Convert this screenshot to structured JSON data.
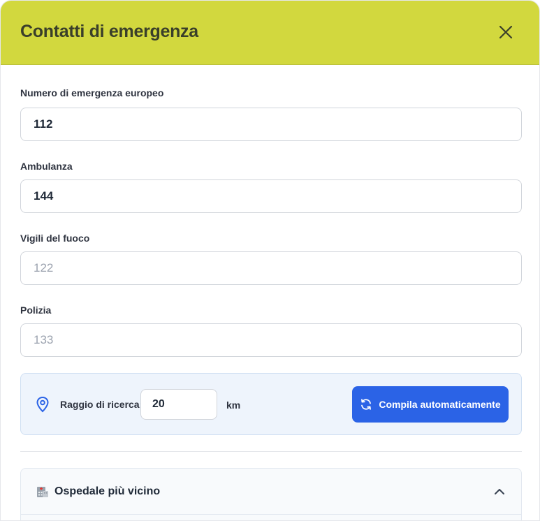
{
  "modal": {
    "title": "Contatti di emergenza",
    "close_icon": "close-icon"
  },
  "fields": [
    {
      "label": "Numero di emergenza europeo",
      "value": "112",
      "placeholder": ""
    },
    {
      "label": "Ambulanza",
      "value": "144",
      "placeholder": ""
    },
    {
      "label": "Vigili del fuoco",
      "value": "",
      "placeholder": "122"
    },
    {
      "label": "Polizia",
      "value": "",
      "placeholder": "133"
    }
  ],
  "radius": {
    "icon": "map-pin-icon",
    "label": "Raggio di ricerca:",
    "value": "20",
    "unit": "km",
    "button_icon": "refresh-icon",
    "button_label": "Compila automaticamente"
  },
  "hospital": {
    "icon": "hospital-icon",
    "title": "Ospedale più vicino",
    "chevron": "chevron-up-icon",
    "expanded": true
  },
  "colors": {
    "header_bg": "#d2d83e",
    "accent": "#2b63e6",
    "panel_bg": "#eef4fc"
  }
}
